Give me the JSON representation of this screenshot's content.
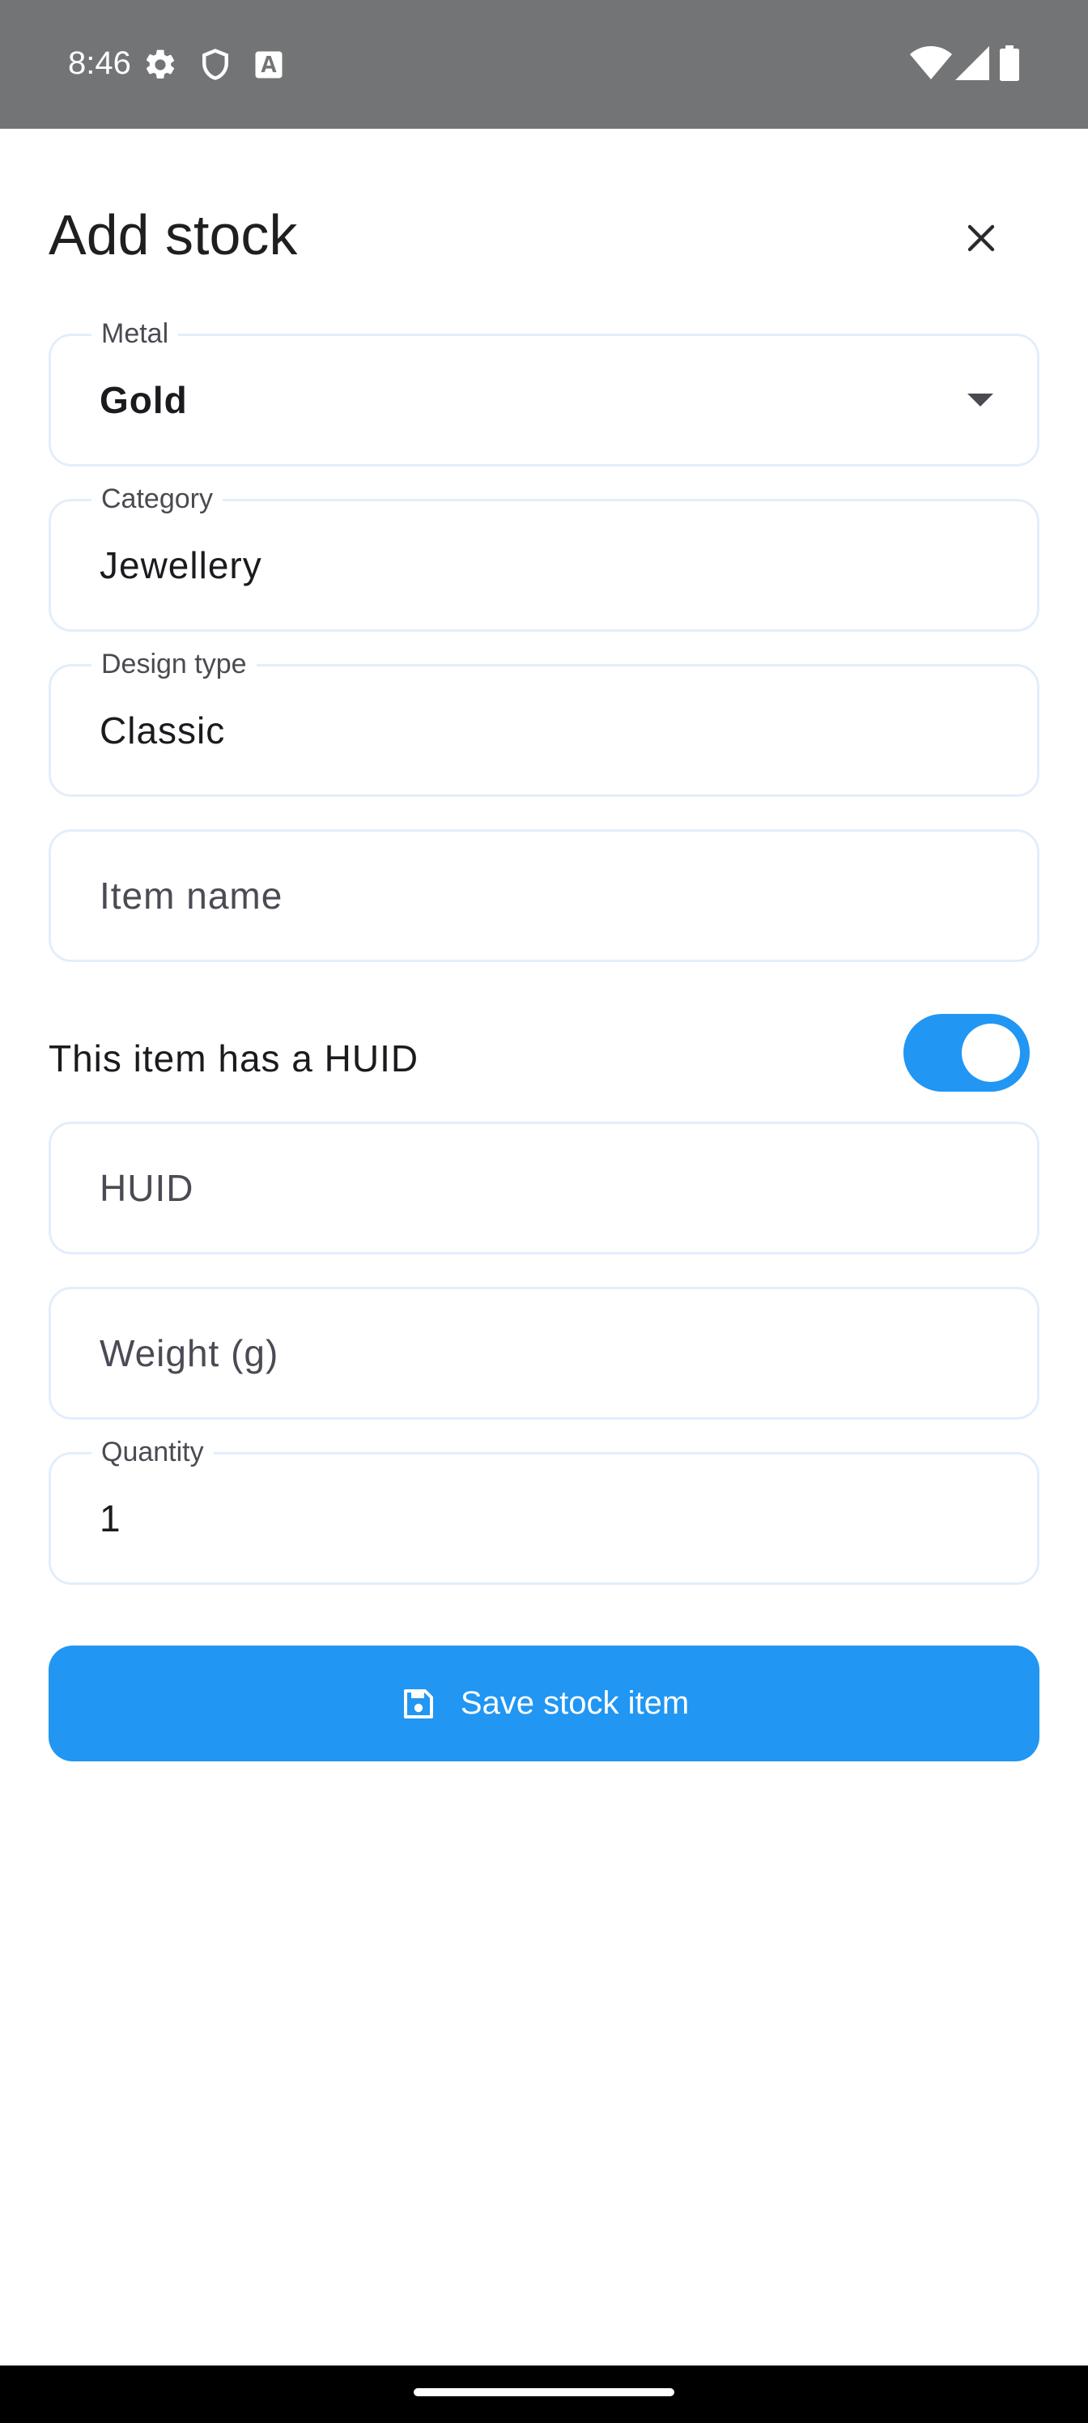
{
  "status_bar": {
    "time": "8:46",
    "left_icons": [
      "settings-icon",
      "shield-icon",
      "font-a-icon"
    ],
    "right_icons": [
      "wifi-icon",
      "cellular-signal-icon",
      "battery-icon"
    ],
    "background": "#737476"
  },
  "dialog": {
    "title": "Add stock",
    "close_icon": "close-icon"
  },
  "form": {
    "metal": {
      "label": "Metal",
      "value": "Gold"
    },
    "category": {
      "label": "Category",
      "value": "Jewellery"
    },
    "design_type": {
      "label": "Design type",
      "value": "Classic"
    },
    "item_name": {
      "placeholder": "Item name",
      "value": ""
    },
    "huid_toggle": {
      "label": "This item has a HUID",
      "on": true
    },
    "huid": {
      "placeholder": "HUID",
      "value": ""
    },
    "weight": {
      "placeholder": "Weight (g)",
      "value": ""
    },
    "quantity": {
      "label": "Quantity",
      "value": "1"
    }
  },
  "save_button": {
    "label": "Save stock item",
    "icon": "save-icon"
  },
  "colors": {
    "accent": "#2196f3",
    "field_border": "#e3eefc",
    "text_primary": "#1b1b1f",
    "text_secondary": "#4a4a52"
  }
}
